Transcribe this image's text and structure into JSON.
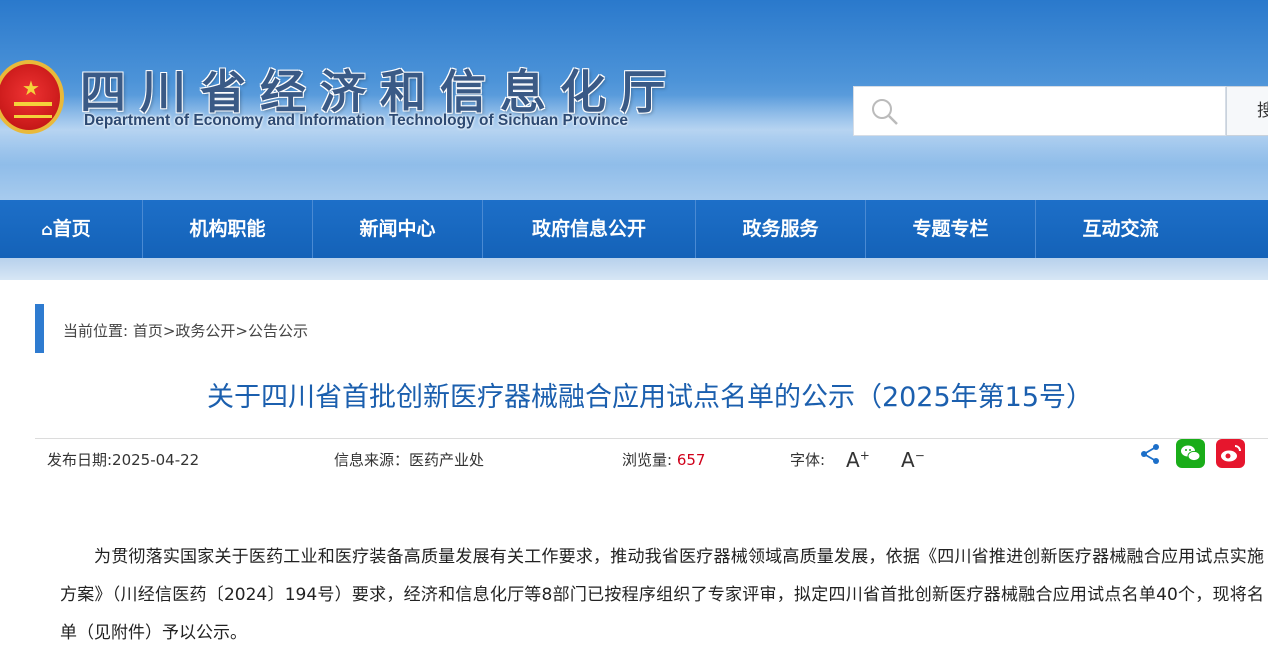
{
  "header": {
    "title_cn": "四川省经济和信息化厅",
    "title_en": "Department of Economy and Information Technology of Sichuan Province",
    "search_placeholder": "",
    "search_button": "搜"
  },
  "nav": {
    "items": [
      {
        "label": "首页",
        "icon": "home-icon"
      },
      {
        "label": "机构职能"
      },
      {
        "label": "新闻中心"
      },
      {
        "label": "政府信息公开"
      },
      {
        "label": "政务服务"
      },
      {
        "label": "专题专栏"
      },
      {
        "label": "互动交流"
      }
    ]
  },
  "breadcrumb": {
    "text": "当前位置: 首页>政务公开>公告公示"
  },
  "article": {
    "title": "关于四川省首批创新医疗器械融合应用试点名单的公示（2025年第15号）",
    "publish_date": "发布日期:2025-04-22",
    "source": "信息来源：医药产业处",
    "views_label": "浏览量: ",
    "views_value": "657",
    "font_label": "字体:",
    "font_increase": "A",
    "font_decrease": "A",
    "body": "为贯彻落实国家关于医药工业和医疗装备高质量发展有关工作要求，推动我省医疗器械领域高质量发展，依据《四川省推进创新医疗器械融合应用试点实施方案》（川经信医药〔2024〕194号）要求，经济和信息化厅等8部门已按程序组织了专家评审，拟定四川省首批创新医疗器械融合应用试点名单40个，现将名单（见附件）予以公示。"
  },
  "share": {
    "icons": [
      "share-icon",
      "wechat-icon",
      "weibo-icon"
    ]
  },
  "colors": {
    "nav_bg": "#1462b8",
    "title_blue": "#1b5fae",
    "accent_bar": "#2e7bd0",
    "views_red": "#d0021b",
    "wechat_green": "#1aad19",
    "weibo_red": "#e6162d"
  }
}
